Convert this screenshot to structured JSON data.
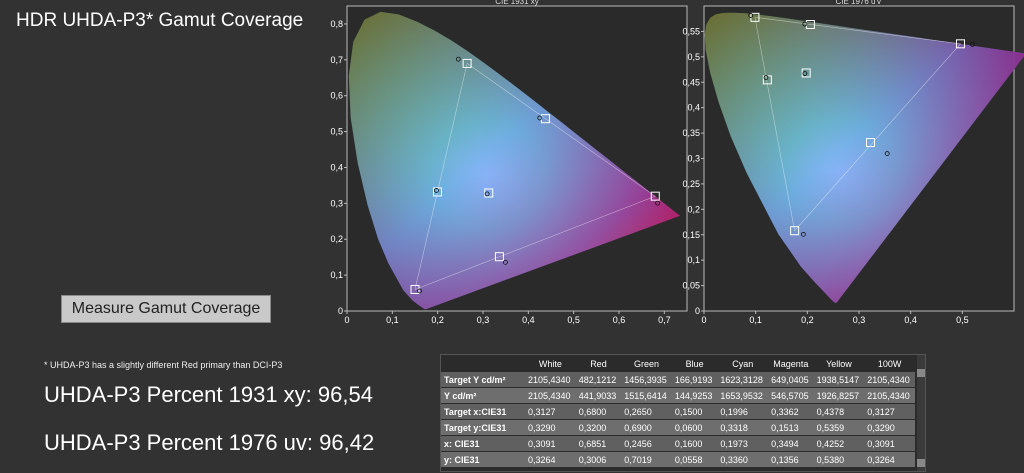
{
  "title": "HDR UHDA-P3* Gamut Coverage",
  "measure_button": "Measure Gamut Coverage",
  "note": "* UHDA-P3 has a slightly different Red primary than DCI-P3",
  "percent_1931": "UHDA-P3 Percent 1931 xy: 96,54",
  "percent_1976": "UHDA-P3 Percent 1976 uv: 96,42",
  "table": {
    "columns": [
      "",
      "White",
      "Red",
      "Green",
      "Blue",
      "Cyan",
      "Magenta",
      "Yellow",
      "100W"
    ],
    "rows": [
      {
        "label": "Target Y cd/m²",
        "values": [
          "2105,4340",
          "482,1212",
          "1456,3935",
          "166,9193",
          "1623,3128",
          "649,0405",
          "1938,5147",
          "2105,4340"
        ]
      },
      {
        "label": "Y cd/m²",
        "values": [
          "2105,4340",
          "441,9033",
          "1515,6414",
          "144,9253",
          "1653,9532",
          "546,5705",
          "1926,8257",
          "2105,4340"
        ]
      },
      {
        "label": "Target x:CIE31",
        "values": [
          "0,3127",
          "0,6800",
          "0,2650",
          "0,1500",
          "0,1996",
          "0,3362",
          "0,4378",
          "0,3127"
        ]
      },
      {
        "label": "Target y:CIE31",
        "values": [
          "0,3290",
          "0,3200",
          "0,6900",
          "0,0600",
          "0,3318",
          "0,1513",
          "0,5359",
          "0,3290"
        ]
      },
      {
        "label": "x: CIE31",
        "values": [
          "0,3091",
          "0,6851",
          "0,2456",
          "0,1600",
          "0,1973",
          "0,3494",
          "0,4252",
          "0,3091"
        ]
      },
      {
        "label": "y: CIE31",
        "values": [
          "0,3264",
          "0,3006",
          "0,7019",
          "0,0558",
          "0,3360",
          "0,1356",
          "0,5380",
          "0,3264"
        ]
      }
    ]
  },
  "chart_data": [
    {
      "type": "scatter",
      "title": "CIE 1931 xy",
      "xlim": [
        0,
        0.75
      ],
      "ylim": [
        0,
        0.85
      ],
      "xticks": [
        "0",
        "0,1",
        "0,2",
        "0,3",
        "0,4",
        "0,5",
        "0,6",
        "0,7"
      ],
      "yticks": [
        "0",
        "0,1",
        "0,2",
        "0,3",
        "0,4",
        "0,5",
        "0,6",
        "0,7",
        "0,8"
      ],
      "target": {
        "x": [
          0.3127,
          0.68,
          0.265,
          0.15,
          0.1996,
          0.3362,
          0.4378
        ],
        "y": [
          0.329,
          0.32,
          0.69,
          0.06,
          0.3318,
          0.1513,
          0.5359
        ]
      },
      "measured": {
        "x": [
          0.3091,
          0.6851,
          0.2456,
          0.16,
          0.1973,
          0.3494,
          0.4252
        ],
        "y": [
          0.3264,
          0.3006,
          0.7019,
          0.0558,
          0.336,
          0.1356,
          0.538
        ]
      },
      "colors": {
        "plot_bg": "#2a2a2a",
        "axis": "#bbbbbb"
      }
    },
    {
      "type": "scatter",
      "title": "CIE 1976 u'v'",
      "xlim": [
        0,
        0.6
      ],
      "ylim": [
        0,
        0.6
      ],
      "xticks": [
        "0",
        "0,1",
        "0,2",
        "0,3",
        "0,4",
        "0,5"
      ],
      "yticks": [
        "0",
        "0,05",
        "0,1",
        "0,15",
        "0,2",
        "0,25",
        "0,3",
        "0,35",
        "0,4",
        "0,45",
        "0,5",
        "0,55"
      ],
      "target": {
        "x": [
          0.1978,
          0.4964,
          0.0986,
          0.1754,
          0.1226,
          0.3223,
          0.2059
        ],
        "y": [
          0.4683,
          0.5256,
          0.5777,
          0.1579,
          0.4547,
          0.3314,
          0.5636
        ]
      },
      "measured": {
        "x": [
          0.1952,
          0.5195,
          0.0904,
          0.1923,
          0.1199,
          0.3546,
          0.1951
        ],
        "y": [
          0.4671,
          0.5244,
          0.5814,
          0.1508,
          0.4592,
          0.3097,
          0.5645
        ]
      },
      "colors": {
        "plot_bg": "#2a2a2a",
        "axis": "#bbbbbb"
      }
    }
  ]
}
